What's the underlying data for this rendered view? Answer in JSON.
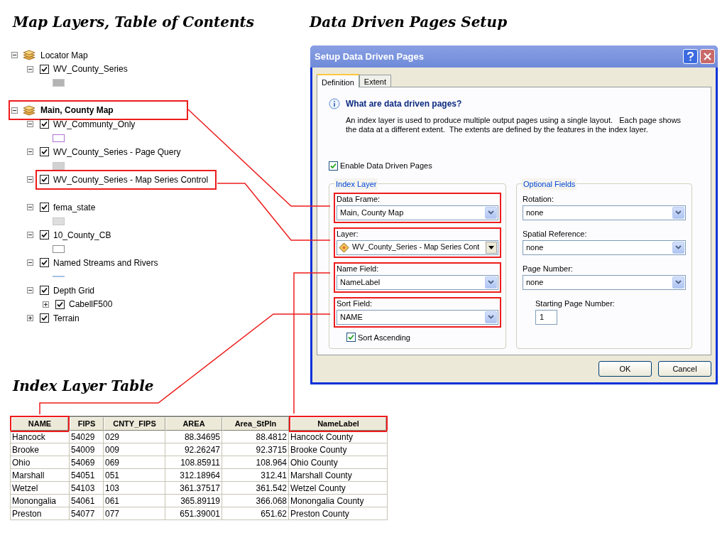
{
  "headings": [
    {
      "text": "Map Layers, Table of Contents"
    },
    {
      "text": "Data Driven Pages Setup"
    },
    {
      "text": "Index Layer Table"
    }
  ],
  "toc": {
    "items": [
      {
        "kind": "dataframe",
        "label": "Locator Map",
        "expanded": true,
        "highlighted": false,
        "children": [
          {
            "kind": "layer",
            "label": "WV_County_Series",
            "checked": true,
            "expanded": true,
            "highlighted": false,
            "swatch": {
              "kind": "fill",
              "color": "#b4b4b4"
            }
          }
        ]
      },
      {
        "kind": "dataframe",
        "label": "Main, County Map",
        "expanded": true,
        "highlighted": true,
        "children": [
          {
            "kind": "layer",
            "label": "WV_Communty_Only",
            "checked": true,
            "expanded": true,
            "highlighted": false,
            "swatch": {
              "kind": "outline",
              "color": "#b070d8"
            }
          },
          {
            "kind": "layer",
            "label": "WV_County_Series - Page Query",
            "checked": true,
            "expanded": true,
            "highlighted": false,
            "swatch": {
              "kind": "fill",
              "color": "#d2d2d2"
            }
          },
          {
            "kind": "layer",
            "label": "WV_County_Series - Map Series Control",
            "checked": true,
            "expanded": true,
            "highlighted": true
          },
          {
            "kind": "layer",
            "label": "fema_state",
            "checked": true,
            "expanded": true,
            "highlighted": false,
            "swatch": {
              "kind": "fill",
              "color": "#dedede"
            }
          },
          {
            "kind": "layer",
            "label": "10_County_CB",
            "checked": true,
            "expanded": true,
            "highlighted": false,
            "swatch": {
              "kind": "outline",
              "color": "#8c8c8c"
            }
          },
          {
            "kind": "layer",
            "label": "Named Streams and Rivers",
            "checked": true,
            "expanded": true,
            "highlighted": false,
            "swatch": {
              "kind": "line",
              "color": "#a4c2e4"
            }
          },
          {
            "kind": "layer",
            "label": "Depth Grid",
            "checked": true,
            "expanded": true,
            "highlighted": false,
            "children": [
              {
                "kind": "layer",
                "label": "CabellF500",
                "checked": true,
                "expanded": false,
                "highlighted": false
              }
            ]
          },
          {
            "kind": "layer",
            "label": "Terrain",
            "checked": true,
            "expanded": false,
            "highlighted": false
          }
        ]
      }
    ]
  },
  "dialog": {
    "title": "Setup Data Driven Pages",
    "tabs": [
      {
        "label": "Definition",
        "selected": true
      },
      {
        "label": "Extent",
        "selected": false
      }
    ],
    "info_title": "What are data driven pages?",
    "info_text": "An index layer is used to produce multiple output pages using a single layout.   Each page shows the data at a different extent.  The extents are defined by the features in the index layer.",
    "enable": {
      "label": "Enable Data Driven Pages",
      "checked": true
    },
    "index_layer": {
      "title": "Index Layer",
      "fields": [
        {
          "kind": "select",
          "label": "Data Frame:",
          "value": "Main, County Map",
          "highlighted": true
        },
        {
          "kind": "layer-select",
          "label": "Layer:",
          "value": "WV_County_Series - Map Series Cont",
          "highlighted": true
        },
        {
          "kind": "select",
          "label": "Name Field:",
          "value": "NameLabel",
          "highlighted": true
        },
        {
          "kind": "select",
          "label": "Sort Field:",
          "value": "NAME",
          "highlighted": true
        }
      ],
      "sort_ascending": {
        "label": "Sort Ascending",
        "checked": true
      }
    },
    "optional_fields": {
      "title": "Optional Fields",
      "fields": [
        {
          "kind": "select",
          "label": "Rotation:",
          "value": "none"
        },
        {
          "kind": "select",
          "label": "Spatial Reference:",
          "value": "none"
        },
        {
          "kind": "select",
          "label": "Page Number:",
          "value": "none"
        },
        {
          "kind": "text",
          "label": "Starting Page Number:",
          "value": "1"
        }
      ]
    },
    "buttons": [
      "OK",
      "Cancel"
    ]
  },
  "table": {
    "columns": [
      {
        "label": "NAME",
        "kind": "text",
        "highlighted": true
      },
      {
        "label": "FIPS",
        "kind": "text",
        "highlighted": false
      },
      {
        "label": "CNTY_FIPS",
        "kind": "text",
        "highlighted": false
      },
      {
        "label": "AREA",
        "kind": "number",
        "highlighted": false
      },
      {
        "label": "Area_StPln",
        "kind": "number",
        "highlighted": false
      },
      {
        "label": "NameLabel",
        "kind": "text",
        "highlighted": true
      }
    ],
    "rows": [
      [
        "Hancock",
        "54029",
        "029",
        "88.34695",
        "88.4812",
        "Hancock County"
      ],
      [
        "Brooke",
        "54009",
        "009",
        "92.26247",
        "92.3715",
        "Brooke County"
      ],
      [
        "Ohio",
        "54069",
        "069",
        "108.85911",
        "108.964",
        "Ohio County"
      ],
      [
        "Marshall",
        "54051",
        "051",
        "312.18964",
        "312.41",
        "Marshall County"
      ],
      [
        "Wetzel",
        "54103",
        "103",
        "361.37517",
        "361.542",
        "Wetzel County"
      ],
      [
        "Monongalia",
        "54061",
        "061",
        "365.89119",
        "366.068",
        "Monongalia County"
      ],
      [
        "Preston",
        "54077",
        "077",
        "651.39001",
        "651.62",
        "Preston County"
      ]
    ]
  }
}
